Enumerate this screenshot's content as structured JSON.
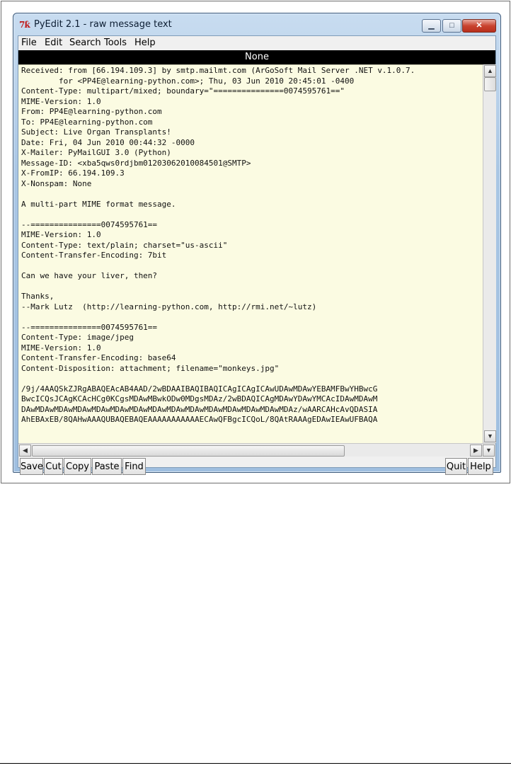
{
  "window": {
    "title": "PyEdit 2.1 - raw message text",
    "icon_text": "7ƙ",
    "controls": {
      "minimize": "▁",
      "maximize": "□",
      "close": "✕"
    }
  },
  "menu": [
    "File",
    "Edit",
    "Search",
    "Tools",
    "Help"
  ],
  "status": "None",
  "text_lines": [
    "Received: from [66.194.109.3] by smtp.mailmt.com (ArGoSoft Mail Server .NET v.1.0.7.",
    "        for <PP4E@learning-python.com>; Thu, 03 Jun 2010 20:45:01 -0400",
    "Content-Type: multipart/mixed; boundary=\"===============0074595761==\"",
    "MIME-Version: 1.0",
    "From: PP4E@learning-python.com",
    "To: PP4E@learning-python.com",
    "Subject: Live Organ Transplants!",
    "Date: Fri, 04 Jun 2010 00:44:32 -0000",
    "X-Mailer: PyMailGUI 3.0 (Python)",
    "Message-ID: <xba5qws0rdjbm01203062010084501@SMTP>",
    "X-FromIP: 66.194.109.3",
    "X-Nonspam: None",
    "",
    "A multi-part MIME format message.",
    "",
    "--===============0074595761==",
    "MIME-Version: 1.0",
    "Content-Type: text/plain; charset=\"us-ascii\"",
    "Content-Transfer-Encoding: 7bit",
    "",
    "Can we have your liver, then?",
    "",
    "Thanks,",
    "--Mark Lutz  (http://learning-python.com, http://rmi.net/~lutz)",
    "",
    "--===============0074595761==",
    "Content-Type: image/jpeg",
    "MIME-Version: 1.0",
    "Content-Transfer-Encoding: base64",
    "Content-Disposition: attachment; filename=\"monkeys.jpg\"",
    "",
    "/9j/4AAQSkZJRgABAQEAcAB4AAD/2wBDAAIBAQIBAQICAgICAgICAwUDAwMDAwYEBAMFBwYHBwcG",
    "BwcICQsJCAgKCAcHCg0KCgsMDAwMBwkODw0MDgsMDAz/2wBDAQICAgMDAwYDAwYMCAcIDAwMDAwM",
    "DAwMDAwMDAwMDAwMDAwMDAwMDAwMDAwMDAwMDAwMDAwMDAwMDAwMDAwMDAz/wAARCAHcAvQDASIA",
    "AhEBAxEB/8QAHwAAAQUBAQEBAQEAAAAAAAAAAAECAwQFBgcICQoL/8QAtRAAAgEDAwIEAwUFBAQA"
  ],
  "buttons_left": [
    "Save",
    "Cut",
    "Copy",
    "Paste",
    "Find"
  ],
  "buttons_right": [
    "Quit",
    "Help"
  ],
  "scroll_arrows": {
    "up": "▲",
    "down": "▼",
    "left": "◀",
    "right": "▶"
  }
}
